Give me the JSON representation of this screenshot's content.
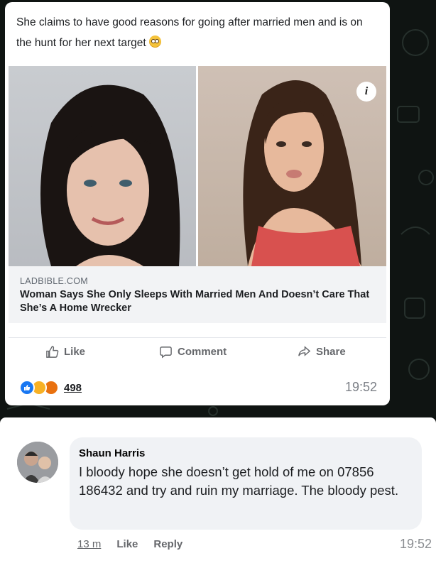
{
  "post": {
    "caption": "She claims to have good reasons for going after married men and is on the hunt for her next target",
    "emoji_icon": "flushed-face-emoji",
    "link": {
      "domain": "LADBIBLE.COM",
      "headline": "Woman Says She Only Sleeps With Married Men And Doesn’t Care That She’s A Home Wrecker"
    },
    "info_badge": "i",
    "actions": {
      "like": "Like",
      "comment": "Comment",
      "share": "Share"
    },
    "reactions": {
      "icons": [
        "like-reaction-icon",
        "haha-reaction-icon",
        "angry-reaction-icon"
      ],
      "count": "498"
    },
    "timestamp": "19:52"
  },
  "comment": {
    "author": "Shaun Harris",
    "text": "I bloody hope she doesn’t get hold of me on 07856 186432 and try and ruin my marriage. The bloody pest.",
    "time_ago": "13 m",
    "like_label": "Like",
    "reply_label": "Reply",
    "timestamp": "19:52"
  },
  "colors": {
    "facebook_blue": "#1877f2",
    "text_dark": "#1c1e21",
    "text_muted": "#65676b",
    "background": "#0f1412"
  }
}
